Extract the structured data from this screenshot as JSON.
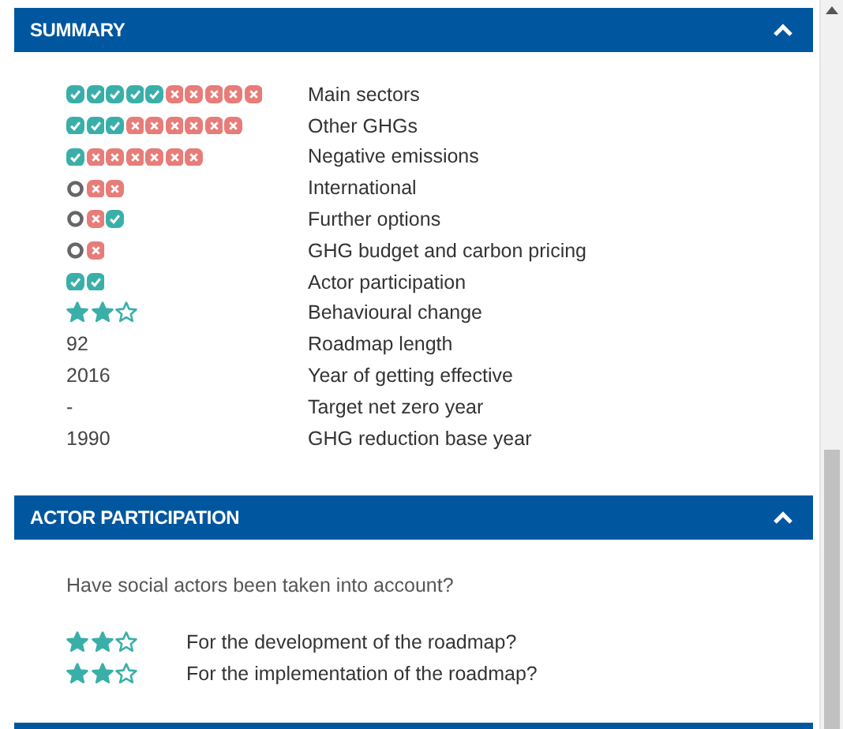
{
  "sections": [
    {
      "title": "SUMMARY",
      "expanded": true,
      "rows": [
        {
          "kind": "marks",
          "marks": [
            {
              "kind": "yes"
            },
            {
              "kind": "yes"
            },
            {
              "kind": "yes"
            },
            {
              "kind": "yes"
            },
            {
              "kind": "yes"
            },
            {
              "kind": "no"
            },
            {
              "kind": "no"
            },
            {
              "kind": "no"
            },
            {
              "kind": "no"
            },
            {
              "kind": "no"
            }
          ],
          "label": "Main sectors"
        },
        {
          "kind": "marks",
          "marks": [
            {
              "kind": "yes"
            },
            {
              "kind": "yes"
            },
            {
              "kind": "yes"
            },
            {
              "kind": "no"
            },
            {
              "kind": "no"
            },
            {
              "kind": "no"
            },
            {
              "kind": "no"
            },
            {
              "kind": "no"
            },
            {
              "kind": "no"
            }
          ],
          "label": "Other GHGs"
        },
        {
          "kind": "marks",
          "marks": [
            {
              "kind": "yes"
            },
            {
              "kind": "no"
            },
            {
              "kind": "no"
            },
            {
              "kind": "no"
            },
            {
              "kind": "no"
            },
            {
              "kind": "no"
            },
            {
              "kind": "no"
            }
          ],
          "label": "Negative emissions"
        },
        {
          "kind": "marks",
          "marks": [
            {
              "kind": "neutral"
            },
            {
              "kind": "no"
            },
            {
              "kind": "no"
            }
          ],
          "label": "International"
        },
        {
          "kind": "marks",
          "marks": [
            {
              "kind": "neutral"
            },
            {
              "kind": "no"
            },
            {
              "kind": "yes"
            }
          ],
          "label": "Further options"
        },
        {
          "kind": "marks",
          "marks": [
            {
              "kind": "neutral"
            },
            {
              "kind": "no"
            }
          ],
          "label": "GHG budget and carbon pricing"
        },
        {
          "kind": "marks",
          "marks": [
            {
              "kind": "yes"
            },
            {
              "kind": "yes"
            }
          ],
          "label": "Actor participation"
        },
        {
          "kind": "stars",
          "stars": 2,
          "label": "Behavioural change"
        },
        {
          "kind": "text",
          "value": "92",
          "label": "Roadmap length"
        },
        {
          "kind": "text",
          "value": "2016",
          "label": "Year of getting effective"
        },
        {
          "kind": "text",
          "value": "-",
          "label": "Target net zero year"
        },
        {
          "kind": "text",
          "value": "1990",
          "label": "GHG reduction base year"
        }
      ]
    },
    {
      "title": "ACTOR PARTICIPATION",
      "expanded": true,
      "question": "Have social actors been taken into account?",
      "rows": [
        {
          "kind": "stars",
          "stars": 2,
          "label": "For the development of the roadmap?"
        },
        {
          "kind": "stars",
          "stars": 2,
          "label": "For the implementation of the roadmap?"
        }
      ]
    }
  ]
}
